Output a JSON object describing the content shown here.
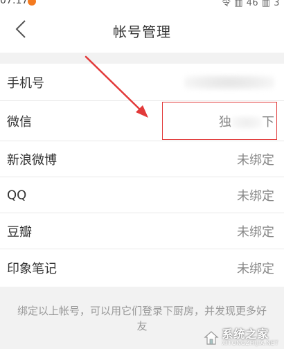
{
  "statusbar": {
    "time": "07:17",
    "right": "令 ▥ 46 ▥ 3"
  },
  "header": {
    "title": "帐号管理"
  },
  "accounts": [
    {
      "label": "手机号",
      "value": ""
    },
    {
      "label": "微信",
      "value_prefix": "独",
      "value_suffix": "下"
    },
    {
      "label": "新浪微博",
      "value": "未绑定"
    },
    {
      "label": "QQ",
      "value": "未绑定"
    },
    {
      "label": "豆瓣",
      "value": "未绑定"
    },
    {
      "label": "印象笔记",
      "value": "未绑定"
    }
  ],
  "footer": {
    "note": "绑定以上帐号，可以用它们登录下厨房，并发现更多好友"
  },
  "watermark": {
    "cn": "系统之家",
    "en": "XITONGZHIJIA.NET"
  },
  "colors": {
    "annotation": "#e23a3a",
    "status_dot": "#f47b20"
  },
  "icons": {
    "back": "chevron-left-icon",
    "watermark_logo": "house-logo-icon"
  }
}
